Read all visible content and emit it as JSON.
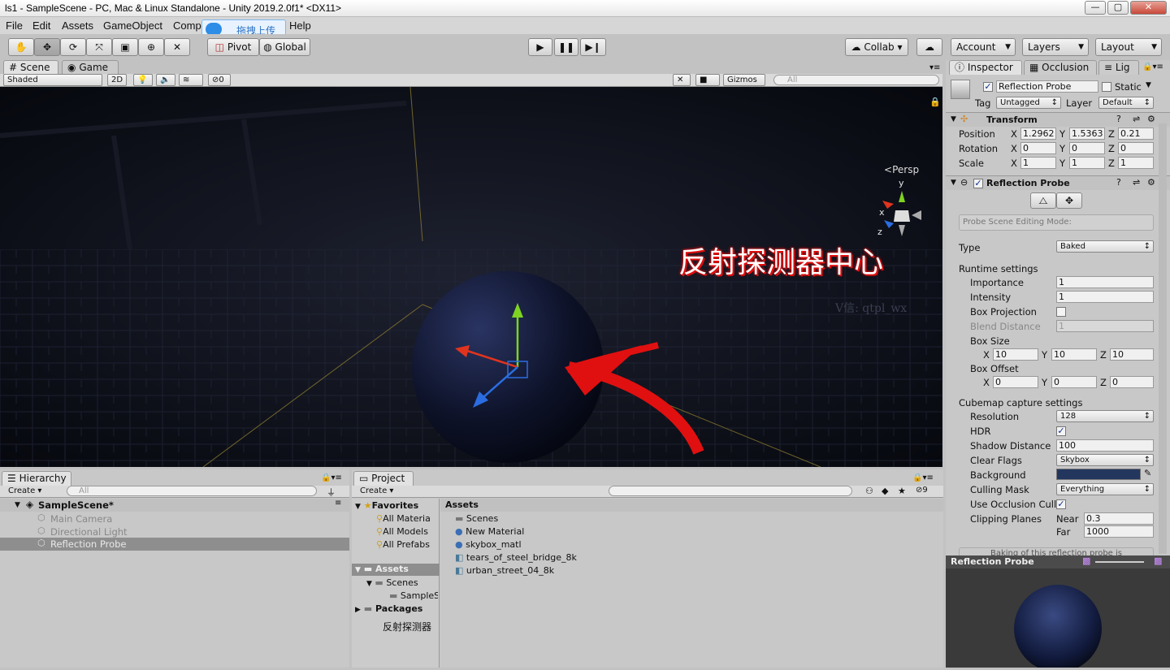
{
  "window": {
    "title": "ls1 - SampleScene - PC, Mac & Linux Standalone - Unity 2019.2.0f1* <DX11>",
    "min": "—",
    "max": "▢",
    "close": "✕"
  },
  "menu": [
    "File",
    "Edit",
    "Assets",
    "GameObject",
    "Comp",
    "Help"
  ],
  "upload_overlay": "拖拽上传",
  "toolbar": {
    "pivot": "Pivot",
    "global": "Global",
    "collab": "Collab ▾",
    "account": "Account",
    "layers": "Layers",
    "layout": "Layout"
  },
  "scene_tabs": {
    "scene": "Scene",
    "game": "Game"
  },
  "scene_bar": {
    "shading": "Shaded",
    "mode2d": "2D",
    "hidden_count": "0",
    "gizmos": "Gizmos",
    "search_placeholder": "All"
  },
  "scene": {
    "persp": "Persp",
    "annotation": "反射探测器中心",
    "watermark": "V信: qtpl_wx",
    "axis": {
      "x": "x",
      "y": "y",
      "z": "z"
    }
  },
  "hierarchy": {
    "tab": "Hierarchy",
    "create": "Create",
    "search_placeholder": "All",
    "scene": "SampleScene*",
    "items": [
      "Main Camera",
      "Directional Light",
      "Reflection Probe"
    ]
  },
  "project": {
    "tab": "Project",
    "create": "Create",
    "hidden_count": "9",
    "favorites_label": "Favorites",
    "favorites": [
      "All Materia",
      "All Models",
      "All Prefabs"
    ],
    "tree": {
      "assets": "Assets",
      "scenes": "Scenes",
      "sample": "SampleS",
      "packages": "Packages",
      "extra": "反射探测器"
    },
    "assets_header": "Assets",
    "assets": [
      "Scenes",
      "New Material",
      "skybox_matl",
      "tears_of_steel_bridge_8k",
      "urban_street_04_8k"
    ]
  },
  "inspector": {
    "tabs": [
      "Inspector",
      "Occlusion",
      "Lig"
    ],
    "object_name": "Reflection Probe",
    "static_label": "Static",
    "tag_label": "Tag",
    "tag": "Untagged",
    "layer_label": "Layer",
    "layer": "Default",
    "transform": {
      "title": "Transform",
      "position_label": "Position",
      "rotation_label": "Rotation",
      "scale_label": "Scale",
      "position": [
        "1.2962",
        "1.5363",
        "0.21"
      ],
      "rotation": [
        "0",
        "0",
        "0"
      ],
      "scale": [
        "1",
        "1",
        "1"
      ]
    },
    "probe": {
      "title": "Reflection Probe",
      "editing_mode": "Probe Scene Editing Mode:",
      "type_label": "Type",
      "type": "Baked",
      "runtime": "Runtime settings",
      "importance_label": "Importance",
      "importance": "1",
      "intensity_label": "Intensity",
      "intensity": "1",
      "box_projection_label": "Box Projection",
      "blend_label": "Blend Distance",
      "blend": "1",
      "box_size_label": "Box Size",
      "box_size": [
        "10",
        "10",
        "10"
      ],
      "box_offset_label": "Box Offset",
      "box_offset": [
        "0",
        "0",
        "0"
      ],
      "cubemap": "Cubemap capture settings",
      "resolution_label": "Resolution",
      "resolution": "128",
      "hdr_label": "HDR",
      "shadow_label": "Shadow Distance",
      "shadow": "100",
      "clear_label": "Clear Flags",
      "clear": "Skybox",
      "background_label": "Background",
      "culling_label": "Culling Mask",
      "culling": "Everything",
      "occlusion_label": "Use Occlusion Cull",
      "clipping_label": "Clipping Planes",
      "near_label": "Near",
      "near": "0.3",
      "far_label": "Far",
      "far": "1000",
      "baking_note": "Baking of this reflection probe is"
    },
    "preview_title": "Reflection Probe"
  },
  "colors": {
    "background_swatch": "#22365e",
    "arrow": "#e01010"
  }
}
